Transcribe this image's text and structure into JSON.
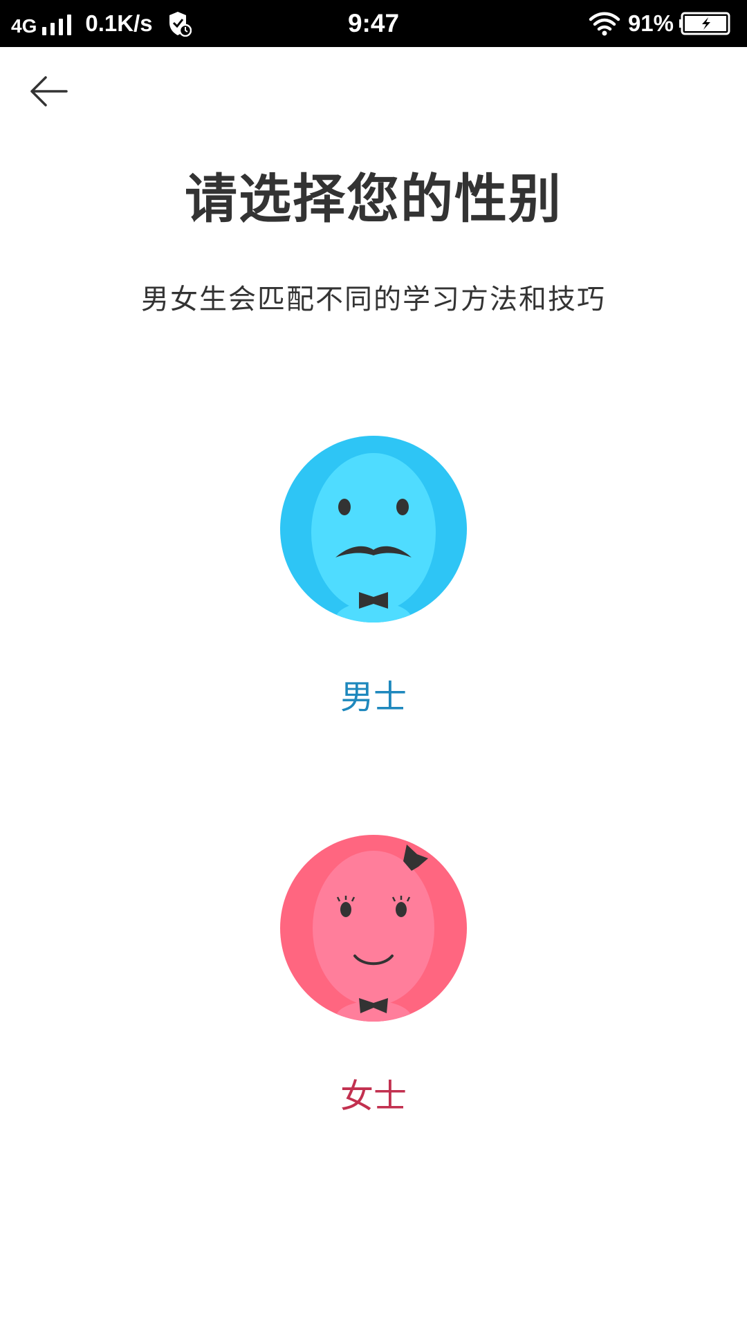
{
  "status_bar": {
    "network": "4G",
    "speed": "0.1K/s",
    "time": "9:47",
    "battery_percent": "91%",
    "icons": [
      "signal-icon",
      "shield-icon",
      "wifi-icon",
      "battery-charging-icon"
    ]
  },
  "header": {
    "back_icon": "arrow-left-icon",
    "title": "请选择您的性别",
    "subtitle": "男女生会匹配不同的学习方法和技巧"
  },
  "options": {
    "male": {
      "label": "男士",
      "avatar_icon": "male-avatar-icon",
      "color": "#1e88bd",
      "avatar_color": "#2ec5f5"
    },
    "female": {
      "label": "女士",
      "avatar_icon": "female-avatar-icon",
      "color": "#c2304f",
      "avatar_color": "#ff6680"
    }
  }
}
